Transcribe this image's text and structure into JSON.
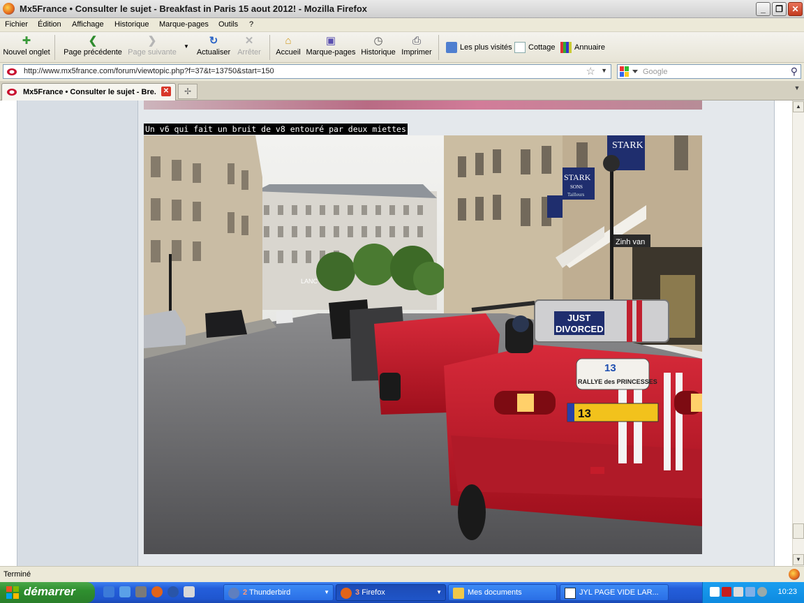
{
  "window": {
    "title": "Mx5France • Consulter le sujet - Breakfast in Paris 15 aout 2012! - Mozilla Firefox"
  },
  "menu": {
    "items": [
      "Fichier",
      "Édition",
      "Affichage",
      "Historique",
      "Marque-pages",
      "Outils",
      "?"
    ]
  },
  "toolbar": {
    "new_tab": "Nouvel onglet",
    "back": "Page précédente",
    "forward": "Page suivante",
    "reload": "Actualiser",
    "stop": "Arrêter",
    "home": "Accueil",
    "bookmarks": "Marque-pages",
    "history": "Historique",
    "print": "Imprimer"
  },
  "bookmarks_bar": {
    "items": [
      "Les plus visités",
      "Cottage",
      "Annuaire"
    ]
  },
  "address": {
    "url": "http://www.mx5france.com/forum/viewtopic.php?f=37&t=13750&start=150"
  },
  "search": {
    "placeholder": "Google"
  },
  "tabs": [
    {
      "label": "Mx5France • Consulter le sujet - Bre..."
    }
  ],
  "post": {
    "caption": "Un v6 qui fait un bruit de v8 entouré par deux miettes",
    "photo": {
      "sign_stark": "STARK",
      "sign_sons": "SONS",
      "sign_tailleur": "Tailleurs",
      "shop_sign": "Zinh van",
      "case_text_1": "JUST",
      "case_text_2": "DIVORCED",
      "rally_number": "13",
      "rally_name": "RALLYE des PRINCESSES",
      "plate": "13",
      "building_text": "LANC"
    }
  },
  "status": {
    "text": "Terminé"
  },
  "taskbar": {
    "start": "démarrer",
    "tasks": [
      {
        "count": "2",
        "label": "Thunderbird"
      },
      {
        "count": "3",
        "label": "Firefox"
      },
      {
        "count": "",
        "label": "Mes documents"
      },
      {
        "count": "",
        "label": "JYL   PAGE VIDE LAR..."
      }
    ],
    "clock": "10:23"
  },
  "colors": {
    "accent": "#245edb",
    "start": "#2f8f2f",
    "sidebar": "#d7dde4"
  }
}
